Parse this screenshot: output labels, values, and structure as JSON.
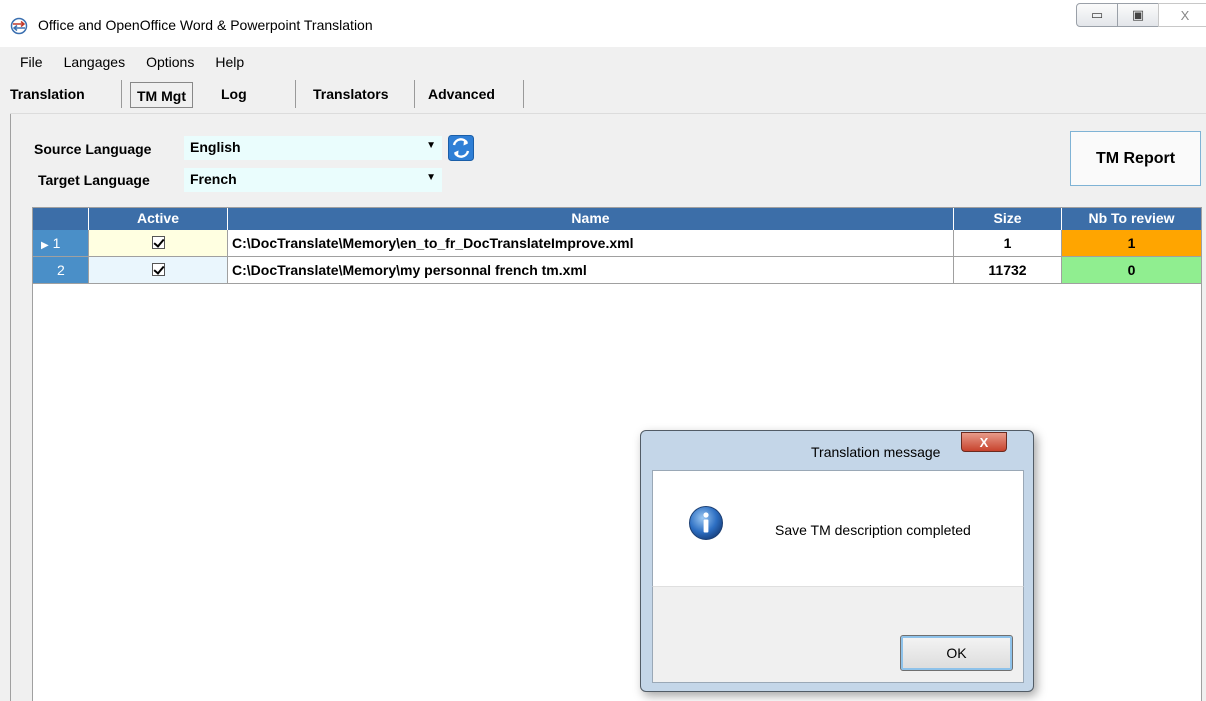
{
  "window": {
    "title": "Office and OpenOffice Word & Powerpoint Translation",
    "minimize_glyph": "▭",
    "maximize_glyph": "▣",
    "close_glyph": "X"
  },
  "menu": [
    "File",
    "Langages",
    "Options",
    "Help"
  ],
  "tabs": [
    {
      "label": "Translation",
      "active": false
    },
    {
      "label": "TM Mgt",
      "active": true
    },
    {
      "label": "Log",
      "active": false
    },
    {
      "label": "Translators",
      "active": false
    },
    {
      "label": "Advanced",
      "active": false
    }
  ],
  "languages": {
    "source_label": "Source Language",
    "source_value": "English",
    "target_label": "Target Language",
    "target_value": "French"
  },
  "tm_report_label": "TM Report",
  "grid": {
    "columns": [
      "Active",
      "Name",
      "Size",
      "Nb To review"
    ],
    "rows": [
      {
        "index": "1",
        "marker": "▶",
        "active": true,
        "name": "C:\\DocTranslate\\Memory\\en_to_fr_DocTranslateImprove.xml",
        "size": "1",
        "to_review": "1",
        "review_color": "#ffa500",
        "current": true
      },
      {
        "index": "2",
        "marker": "",
        "active": true,
        "name": "C:\\DocTranslate\\Memory\\my personnal french tm.xml",
        "size": "11732",
        "to_review": "0",
        "review_color": "#90ee90",
        "current": false
      }
    ]
  },
  "dialog": {
    "title": "Translation message",
    "close_glyph": "X",
    "message": "Save TM description completed",
    "ok_label": "OK",
    "icon": "info-icon"
  },
  "colors": {
    "grid_header": "#3c6ea8",
    "row_header": "#4a8fc8",
    "combo_bg": "#eafdfd"
  }
}
